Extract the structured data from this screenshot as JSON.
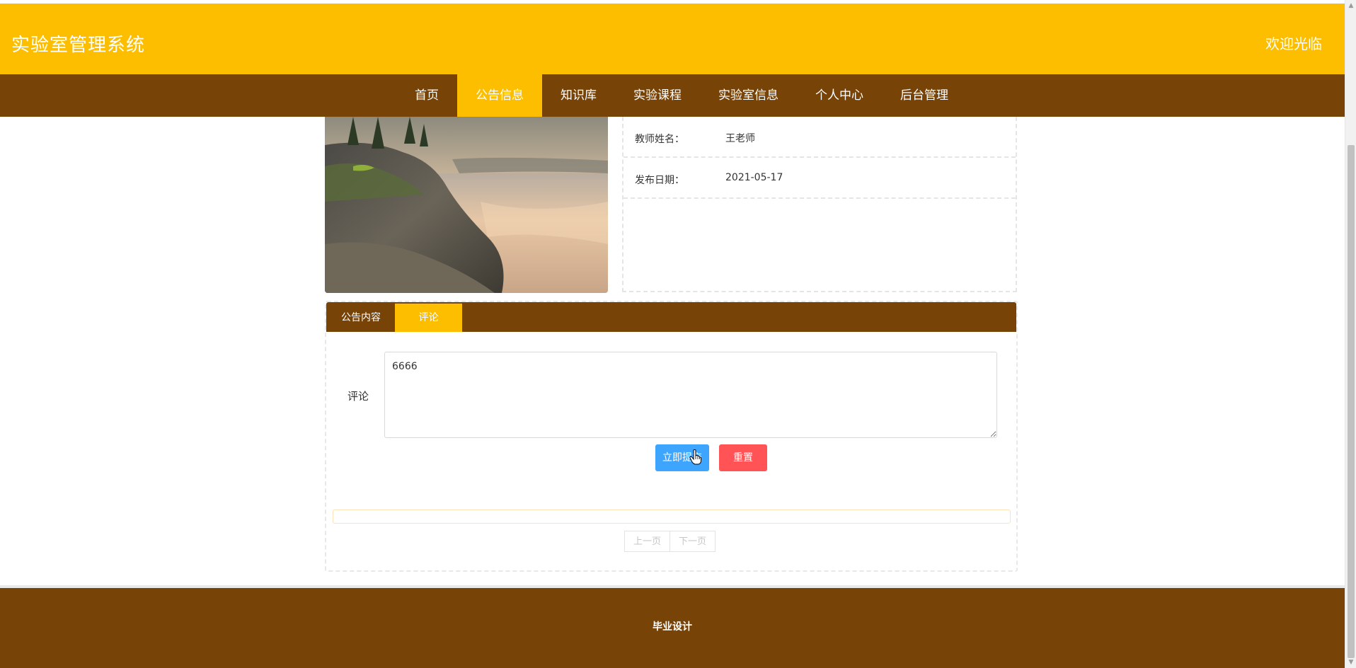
{
  "header": {
    "site_title": "实验室管理系统",
    "welcome": "欢迎光临"
  },
  "nav": {
    "items": [
      {
        "label": "首页"
      },
      {
        "label": "公告信息",
        "active": true
      },
      {
        "label": "知识库"
      },
      {
        "label": "实验课程"
      },
      {
        "label": "实验室信息"
      },
      {
        "label": "个人中心"
      },
      {
        "label": "后台管理"
      }
    ]
  },
  "info": {
    "teacher_label": "教师姓名：",
    "teacher_value": "王老师",
    "date_label": "发布日期：",
    "date_value": "2021-05-17"
  },
  "tabs": {
    "items": [
      {
        "label": "公告内容"
      },
      {
        "label": "评论",
        "active": true
      }
    ]
  },
  "comment_form": {
    "label": "评论",
    "value": "6666",
    "submit_label": "立即提交",
    "reset_label": "重置"
  },
  "pager": {
    "prev_label": "上一页",
    "next_label": "下一页"
  },
  "footer": {
    "text": "毕业设计"
  },
  "colors": {
    "header_bg": "#fdbe00",
    "nav_bg": "#784306",
    "submit": "#3ea5ff",
    "reset": "#ff5355"
  }
}
